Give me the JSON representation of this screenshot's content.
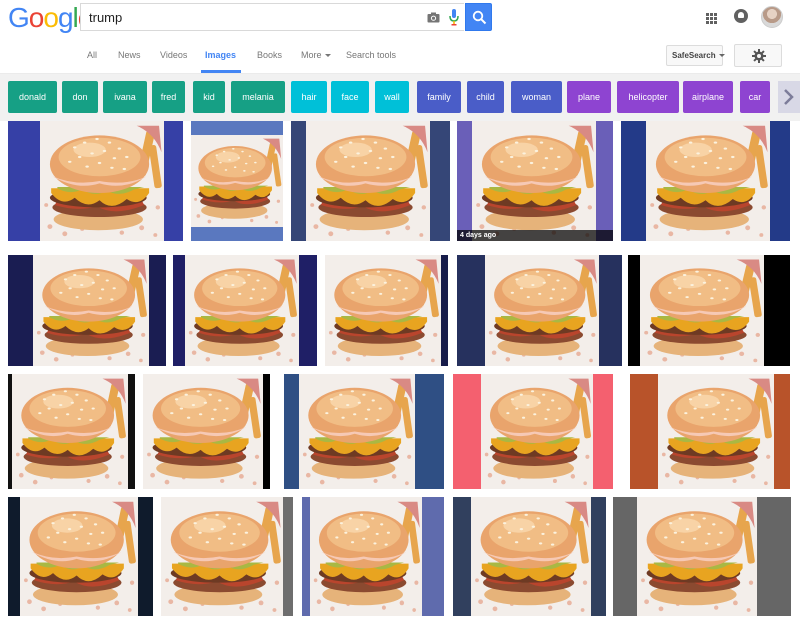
{
  "header": {
    "logo_text": "Google",
    "query": "trump",
    "icons": [
      "camera-icon",
      "microphone-icon",
      "search-icon",
      "apps-grid-icon",
      "notifications-icon",
      "avatar"
    ]
  },
  "nav": {
    "tabs": [
      {
        "label": "All"
      },
      {
        "label": "News"
      },
      {
        "label": "Videos"
      },
      {
        "label": "Images",
        "active": true
      },
      {
        "label": "Books"
      },
      {
        "label": "More"
      },
      {
        "label": "Search tools"
      }
    ],
    "safesearch_label": "SafeSearch",
    "settings_icon": "gear-icon"
  },
  "chips": [
    {
      "label": "donald",
      "color": "#16a085"
    },
    {
      "label": "don",
      "color": "#16a085"
    },
    {
      "label": "ivana",
      "color": "#16a085"
    },
    {
      "label": "fred",
      "color": "#16a085"
    },
    {
      "label": "kid",
      "color": "#16a085"
    },
    {
      "label": "melania",
      "color": "#16a085"
    },
    {
      "label": "hair",
      "color": "#00c0d8"
    },
    {
      "label": "face",
      "color": "#00c0d8"
    },
    {
      "label": "wall",
      "color": "#00c0d8"
    },
    {
      "label": "family",
      "color": "#4a5dc8"
    },
    {
      "label": "child",
      "color": "#4a5dc8"
    },
    {
      "label": "woman",
      "color": "#4a5dc8"
    },
    {
      "label": "plane",
      "color": "#8e44d1"
    },
    {
      "label": "helicopter",
      "color": "#8e44d1"
    },
    {
      "label": "airplane",
      "color": "#8e44d1"
    },
    {
      "label": "car",
      "color": "#8e44d1"
    }
  ],
  "results": {
    "image_subject": "burger with sesame bun, cheese and bacon",
    "rows": [
      [
        {
          "background": "#3640a6"
        },
        {
          "background": "#5a78bf"
        },
        {
          "background": "#354677"
        },
        {
          "background": "#6a5fb8",
          "age_label": "4 days ago"
        },
        {
          "background": "#233a88"
        }
      ],
      [
        {
          "background": "#1a1d52"
        },
        {
          "background": "#1f1f66"
        },
        {
          "background": "#171c4a"
        },
        {
          "background": "#26315e"
        },
        {
          "background": "#000000"
        }
      ],
      [
        {
          "background": "#111111"
        },
        {
          "background": "#000000"
        },
        {
          "background": "#2f4f84"
        },
        {
          "background": "#f4606f"
        },
        {
          "background": "#b8532a"
        }
      ],
      [
        {
          "background": "#0f1b2c"
        },
        {
          "background": "#6e6e6e"
        },
        {
          "background": "#5f6bad"
        },
        {
          "background": "#31405e"
        },
        {
          "background": "#666666"
        }
      ]
    ]
  }
}
